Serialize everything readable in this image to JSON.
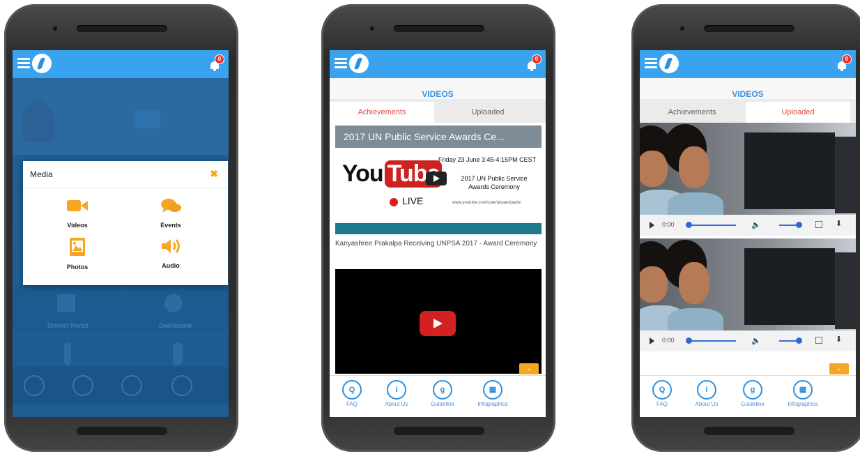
{
  "screens": [
    {
      "notification_count": "0",
      "modal": {
        "title": "Media",
        "close_icon": "close-icon",
        "items": [
          {
            "label": "Videos",
            "icon": "video-camera-icon",
            "color": "#f5a623"
          },
          {
            "label": "Events",
            "icon": "chat-bubbles-icon",
            "color": "#f5a623"
          },
          {
            "label": "Photos",
            "icon": "image-icon",
            "color": "#f5a623"
          },
          {
            "label": "Audio",
            "icon": "speaker-icon",
            "color": "#f5a623"
          }
        ]
      },
      "background_labels": [
        "District Portal",
        "Dashboard"
      ]
    },
    {
      "notification_count": "0",
      "title": "VIDEOS",
      "tabs": [
        {
          "label": "Achievements",
          "active": true
        },
        {
          "label": "Uploaded",
          "active": false
        }
      ],
      "video": {
        "title": "2017 UN Public Service Awards Ce...",
        "logo_you": "You",
        "logo_tube": "Tube",
        "live": "LIVE",
        "info_date": "Friday 23 June 3:45-4:15PM CEST",
        "info_event": "2017 UN Public Service Awards Ceremony",
        "info_url": "www.youtube.com/user/unpanduadm",
        "caption": "Kanyashree Prakalpa Receiving UNPSA 2017 - Award Ceremony"
      },
      "nav": [
        {
          "label": "FAQ",
          "icon": "faq-icon",
          "glyph": "Q"
        },
        {
          "label": "About Us",
          "icon": "info-icon",
          "glyph": "i"
        },
        {
          "label": "Guideline",
          "icon": "guideline-icon",
          "glyph": "g"
        },
        {
          "label": "Infographics",
          "icon": "infographics-icon",
          "glyph": "▦"
        }
      ]
    },
    {
      "notification_count": "0",
      "title": "VIDEOS",
      "tabs": [
        {
          "label": "Achievements",
          "active": false
        },
        {
          "label": "Uploaded",
          "active": true
        }
      ],
      "players": [
        {
          "time": "0:00"
        },
        {
          "time": "0:00"
        }
      ],
      "nav": [
        {
          "label": "FAQ",
          "icon": "faq-icon",
          "glyph": "Q"
        },
        {
          "label": "About Us",
          "icon": "info-icon",
          "glyph": "i"
        },
        {
          "label": "Guideline",
          "icon": "guideline-icon",
          "glyph": "g"
        },
        {
          "label": "Infographics",
          "icon": "infographics-icon",
          "glyph": "▦"
        }
      ]
    }
  ],
  "colors": {
    "appbar": "#3aa3f0",
    "accent": "#f5a623",
    "active_tab": "#e74c3c",
    "nav_blue": "#2f8fd8"
  }
}
